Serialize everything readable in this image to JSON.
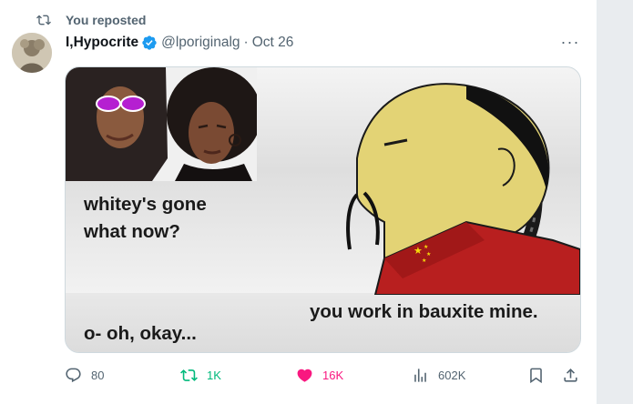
{
  "repost": {
    "label": "You reposted"
  },
  "author": {
    "name": "I,Hypocrite",
    "handle": "@lporiginalg",
    "separator": "·",
    "date": "Oct 26"
  },
  "more": {
    "label": "···"
  },
  "meme": {
    "caption_left_1": "whitey's gone",
    "caption_left_2": "what now?",
    "caption_right": "you work in bauxite  mine.",
    "caption_bottom": "o- oh, okay..."
  },
  "actions": {
    "replies": "80",
    "reposts": "1K",
    "likes": "16K",
    "views": "602K"
  },
  "colors": {
    "accent_blue": "#1d9bf0",
    "repost_green": "#00ba7c",
    "like_pink": "#f91880",
    "muted": "#536471"
  }
}
